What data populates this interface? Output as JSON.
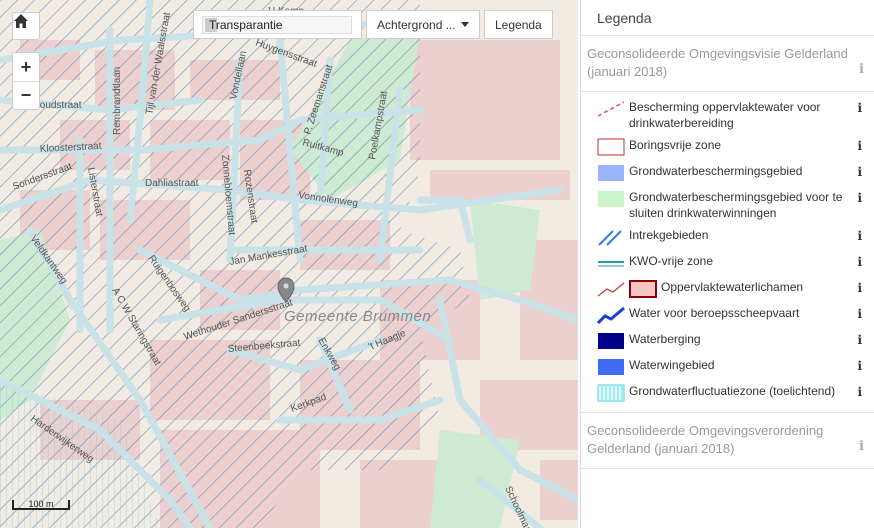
{
  "map": {
    "home_icon": "home-icon",
    "zoom_in": "+",
    "zoom_out": "−",
    "transparency_label": "Transparantie",
    "background_label": "Achtergrond ...",
    "legend_button": "Legenda",
    "scale_label": "100 m",
    "town_label": "Gemeente Brummen",
    "streets": [
      "H Kemp",
      "Rembrandtlaan",
      "Huygensstraat",
      "Vondellaan",
      "P. Zeemanstraat",
      "Poelkampstraat",
      "Kloosterstraat",
      "Listerstraat",
      "Dahliastraat",
      "Zonnebloemstraat",
      "Rozenstraat",
      "Ruitkamp",
      "Vonnolenweg",
      "Jan Mankesstraat",
      "Ruigenbosweg",
      "A C W Staringstraat",
      "Wethouder Sandersstraat",
      "Steenbeekstraat",
      "Enkweg",
      "'t Haagje",
      "Kerkpad",
      "Harderwijkerweg",
      "Schoolmaat",
      "Veldkantweg",
      "Sondersstraat",
      "Goudstraat",
      "Tijl van der Waalsstraat"
    ]
  },
  "legend": {
    "title": "Legenda",
    "info_glyph": "i",
    "groups": [
      {
        "title": "Geconsolideerde Omgevingsvisie Gelderland (januari 2018)",
        "items": [
          {
            "label": "Bescherming oppervlaktewater voor drinkwaterbereiding",
            "icon": "dashed-red-line-icon"
          },
          {
            "label": "Boringsvrije zone",
            "icon": "red-outline-rect-icon"
          },
          {
            "label": "Grondwaterbeschermingsgebied",
            "icon": "blue-fill-rect-icon"
          },
          {
            "label": "Grondwaterbeschermingsgebied voor te sluiten drinkwaterwinningen",
            "icon": "green-fill-rect-icon"
          },
          {
            "label": "Intrekgebieden",
            "icon": "blue-hatch-icon"
          },
          {
            "label": "KWO-vrije zone",
            "icon": "teal-lines-icon"
          },
          {
            "label": "Oppervlaktewaterlichamen",
            "icon": "red-line-and-rect-icon"
          },
          {
            "label": "Water voor beroepsscheepvaart",
            "icon": "blue-zigzag-icon"
          },
          {
            "label": "Waterberging",
            "icon": "navy-fill-rect-icon"
          },
          {
            "label": "Waterwingebied",
            "icon": "royal-blue-rect-icon"
          },
          {
            "label": "Grondwaterfluctuatiezone (toelichtend)",
            "icon": "cyan-hatch-rect-icon"
          }
        ]
      },
      {
        "title": "Geconsolideerde Omgevingsverordening Gelderland (januari 2018)",
        "items": []
      }
    ]
  },
  "colors": {
    "map_bg": "#f2efe9",
    "built_area": "#e8c9c9",
    "green": "#cdebd0",
    "road": "#c7dfe6",
    "hatch": "#5a7fa6"
  }
}
